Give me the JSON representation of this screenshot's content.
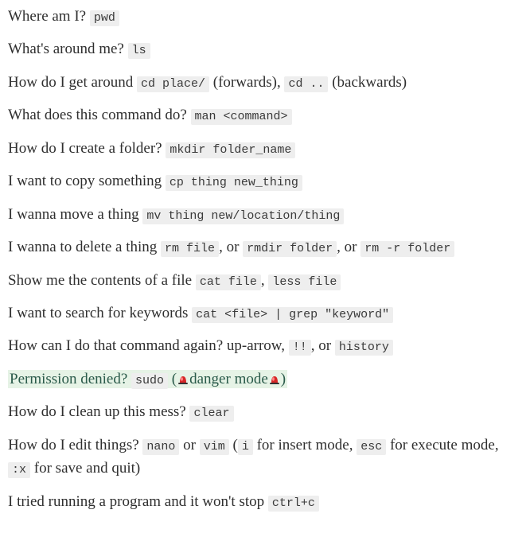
{
  "lines": [
    {
      "q": "Where am I?",
      "c1": "pwd"
    },
    {
      "q": "What's around me?",
      "c1": "ls"
    },
    {
      "q": "How do I get around",
      "c1": "cd place/",
      "m1": " (forwards), ",
      "c2": "cd ..",
      "m2": " (backwards)"
    },
    {
      "q": "What does this command do?",
      "c1": "man <command>"
    },
    {
      "q": "How do I create a folder?",
      "c1": "mkdir folder_name"
    },
    {
      "q": "I want to copy something",
      "c1": "cp thing new_thing"
    },
    {
      "q": "I wanna move a thing",
      "c1": "mv thing new/location/thing"
    },
    {
      "q": "I wanna to delete a thing",
      "c1": "rm file",
      "m1": ", or ",
      "c2": "rmdir folder",
      "m2": ", or ",
      "c3": "rm -r folder"
    },
    {
      "q": "Show me the contents of a file",
      "c1": "cat file",
      "m1": ", ",
      "c2": "less file"
    },
    {
      "q": "I want to search for keywords",
      "c1": "cat <file> | grep \"keyword\""
    },
    {
      "q": "How can I do that command again? up-arrow,",
      "c1": "!!",
      "m1": ", or ",
      "c2": "history"
    },
    {
      "hlq": "Permission denied?",
      "c1": "sudo",
      "paren_open": " (",
      "danger": "danger mode",
      "paren_close": ")"
    },
    {
      "q": "How do I clean up this mess?",
      "c1": "clear"
    },
    {
      "q": "How do I edit things?",
      "c1": "nano",
      "m1": " or ",
      "c2": "vim",
      "m2": " (",
      "c3": "i",
      "m3": " for insert mode, ",
      "c4": "esc",
      "m4": " for execute mode, ",
      "c5": ":x",
      "m5": " for save and quit)"
    },
    {
      "q": "I tried running a program and it won't stop",
      "c1": "ctrl+c"
    }
  ]
}
